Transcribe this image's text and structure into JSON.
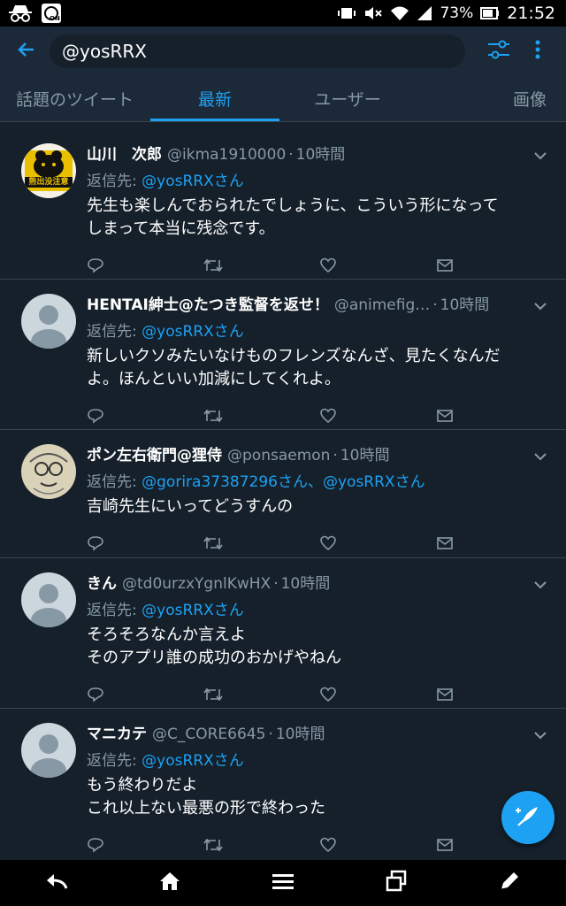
{
  "status_bar": {
    "battery_percent": "73%",
    "time": "21:52",
    "left_icons": [
      "incognito-icon",
      "flash-on-icon"
    ],
    "right_icons": [
      "vibrate-icon",
      "mute-icon",
      "wifi-icon",
      "signal-icon",
      "battery-icon"
    ]
  },
  "app_bar": {
    "search_value": "@yosRRX"
  },
  "tabs": [
    {
      "label": "話題のツイート",
      "active": false
    },
    {
      "label": "最新",
      "active": true
    },
    {
      "label": "ユーザー",
      "active": false
    },
    {
      "label": "画像",
      "active": false
    }
  ],
  "colors": {
    "background": "#15202b",
    "header": "#1c2938",
    "accent": "#1da1f2",
    "secondary_text": "#8899a6",
    "divider": "#38444d"
  },
  "tweets": [
    {
      "name": "山川　次郎",
      "handle": "@ikma1910000",
      "dot": "·",
      "time": "10時間",
      "reply_prefix": "返信先: ",
      "reply_to": "@yosRRXさん",
      "text": "先生も楽しんでおられたでしょうに、こういう形になって\nしまって本当に残念です。",
      "avatar": "bear-avatar",
      "avatar_text": "熊出没注意"
    },
    {
      "name": "HENTAI紳士@たつき監督を返せ！",
      "handle": "@animefig…",
      "dot": "·",
      "time": "10時間",
      "reply_prefix": "返信先: ",
      "reply_to": "@yosRRXさん",
      "text": "新しいクソみたいなけものフレンズなんざ、見たくなんだ\nよ。ほんといい加減にしてくれよ。",
      "avatar": "default-avatar"
    },
    {
      "name": "ポン左右衛門@狸侍",
      "handle": "@ponsaemon",
      "dot": "·",
      "time": "10時間",
      "reply_prefix": "返信先: ",
      "reply_to": "@gorira37387296さん、@yosRRXさん",
      "text": "吉崎先生にいってどうすんの",
      "avatar": "drawn-face-avatar"
    },
    {
      "name": "きん",
      "handle": "@td0urzxYgnlKwHX",
      "dot": "·",
      "time": "10時間",
      "reply_prefix": "返信先: ",
      "reply_to": "@yosRRXさん",
      "text": "そろそろなんか言えよ\nそのアプリ誰の成功のおかげやねん",
      "avatar": "default-avatar"
    },
    {
      "name": "マニカテ",
      "handle": "@C_CORE6645",
      "dot": "·",
      "time": "10時間",
      "reply_prefix": "返信先: ",
      "reply_to": "@yosRRXさん",
      "text": "もう終わりだよ\nこれ以上ない最悪の形で終わった",
      "avatar": "default-avatar"
    }
  ],
  "bottom_nav": [
    "reply-back-icon",
    "home-icon",
    "menu-icon",
    "windows-icon",
    "compose-pen-icon"
  ]
}
